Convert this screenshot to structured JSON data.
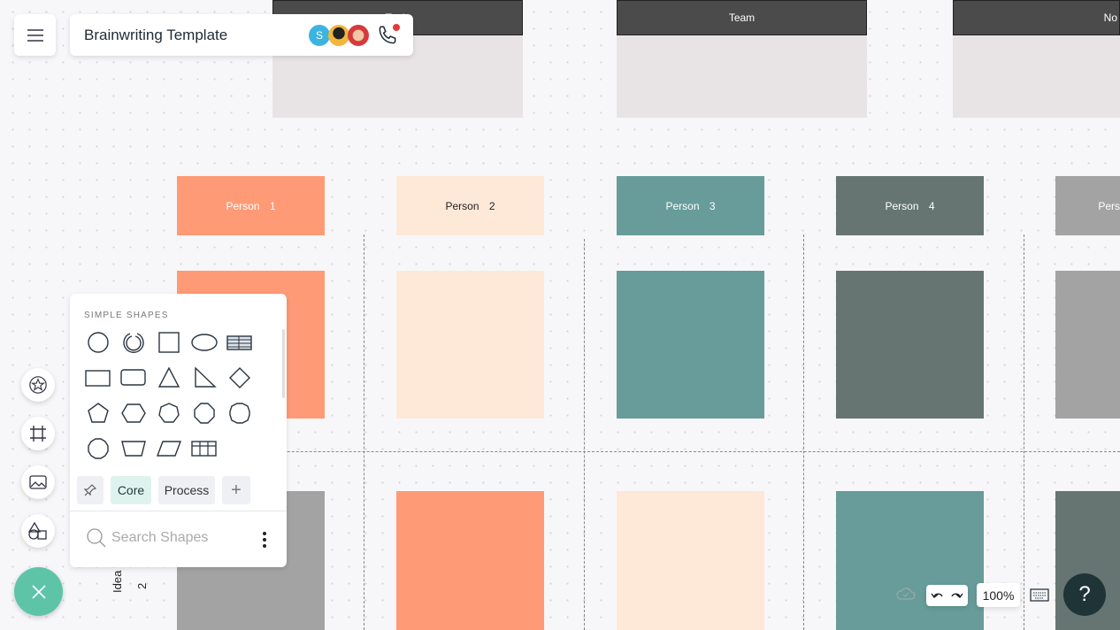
{
  "header": {
    "title": "Brainwriting Template",
    "avatar_initial": "S"
  },
  "board": {
    "columns": [
      {
        "label": "Topic"
      },
      {
        "label": "Team"
      },
      {
        "label": "No"
      }
    ],
    "persons": [
      {
        "label": "Person 1",
        "color": "#fe9a76",
        "text": "#ffffff"
      },
      {
        "label": "Person 2",
        "color": "#fee8d8",
        "text": "#222222"
      },
      {
        "label": "Person 3",
        "color": "#679c9a",
        "text": "#ffffff"
      },
      {
        "label": "Person 4",
        "color": "#667572",
        "text": "#ffffff"
      },
      {
        "label": "Pers",
        "color": "#a3a3a3",
        "text": "#ffffff"
      }
    ],
    "row1_colors": [
      "#fe9a76",
      "#fee8d8",
      "#679c9a",
      "#667572",
      "#a3a3a3"
    ],
    "row2_colors": [
      "#a3a3a3",
      "#fe9a76",
      "#fee8d8",
      "#679c9a",
      "#667572"
    ],
    "row_label": {
      "word": "Idea",
      "number": "2"
    }
  },
  "shapes_panel": {
    "section_title": "SIMPLE SHAPES",
    "tabs": [
      "Core",
      "Process"
    ],
    "active_tab": "Core",
    "search_placeholder": "Search Shapes"
  },
  "bottom_bar": {
    "zoom": "100%",
    "help": "?"
  },
  "colors": {
    "accent": "#5ec4a8",
    "help_bg": "#1f3437"
  }
}
